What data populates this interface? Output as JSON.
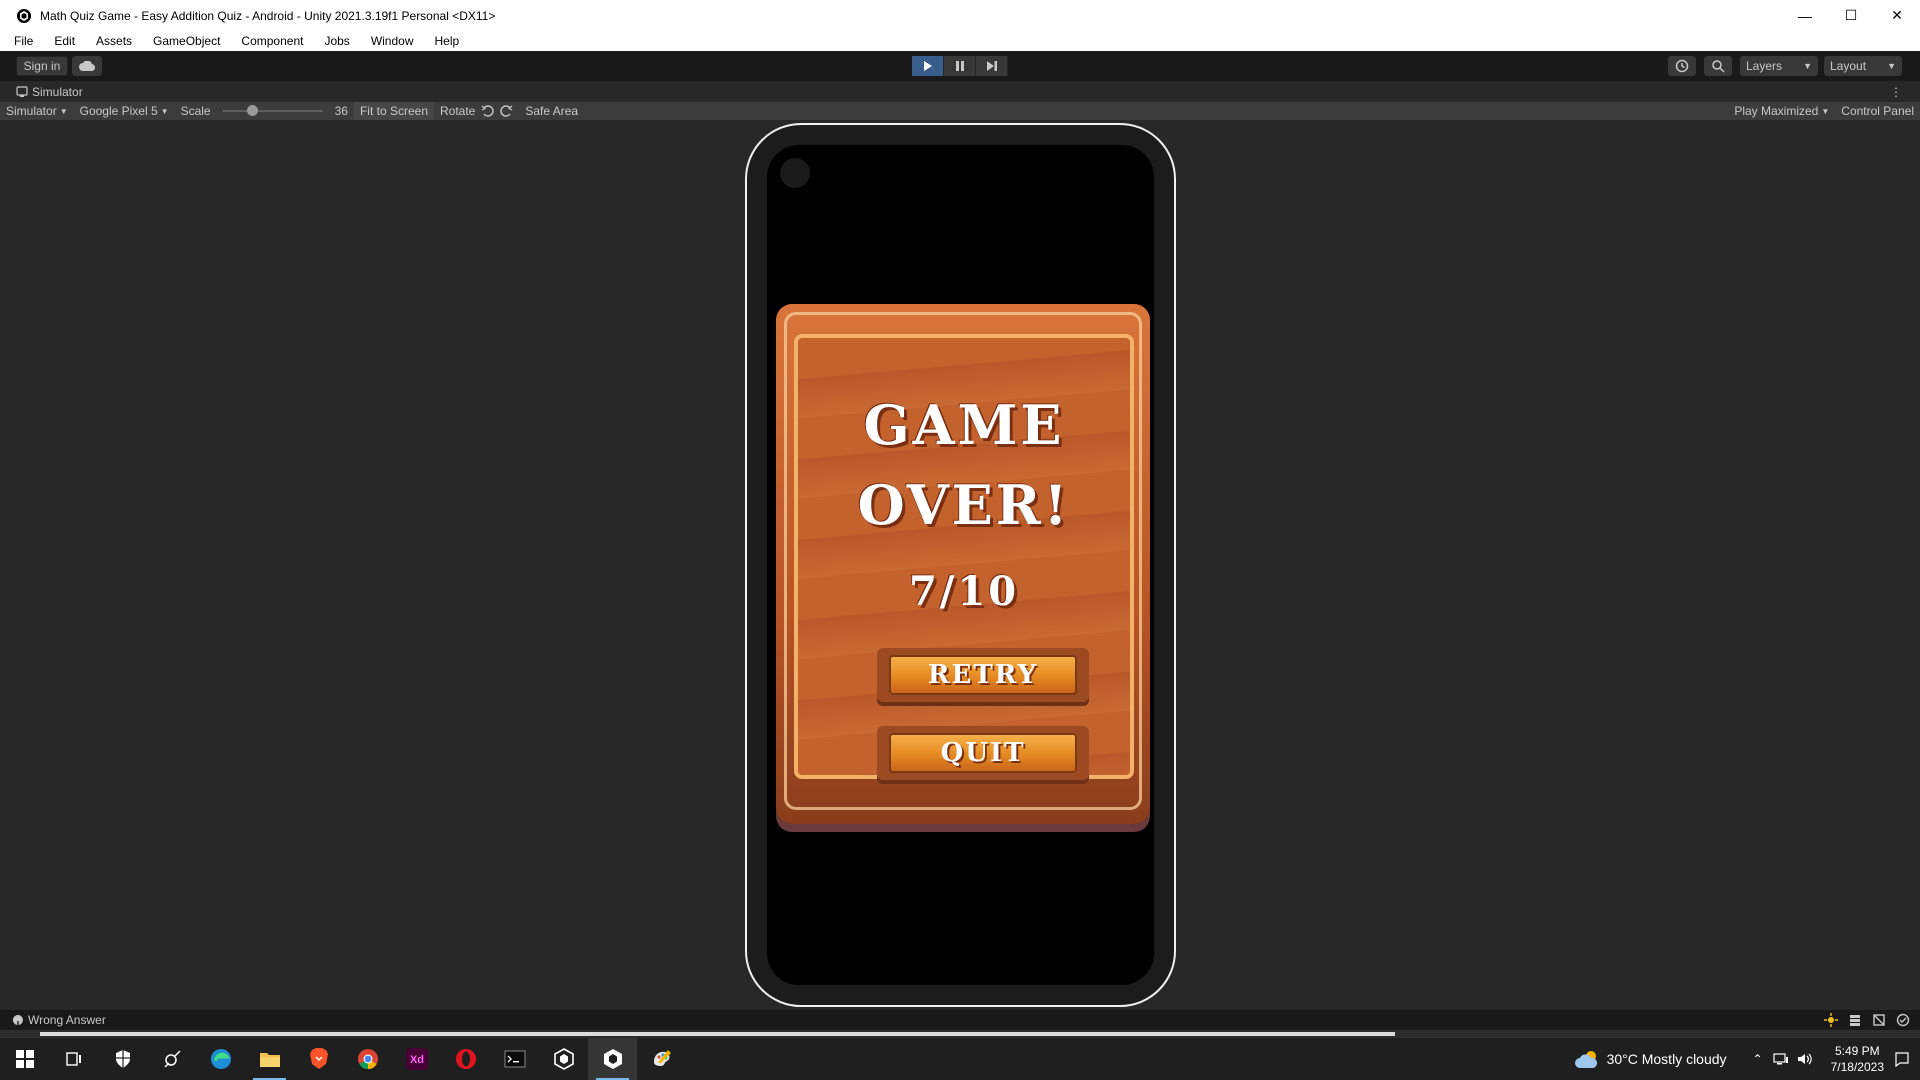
{
  "window": {
    "title": "Math Quiz Game - Easy Addition Quiz - Android - Unity 2021.3.19f1 Personal <DX11>",
    "minimize": "—",
    "maximize": "☐",
    "close": "✕"
  },
  "menu": [
    "File",
    "Edit",
    "Assets",
    "GameObject",
    "Component",
    "Jobs",
    "Window",
    "Help"
  ],
  "toolbar": {
    "sign_in": "Sign in",
    "layers": "Layers",
    "layout": "Layout",
    "play_active": true
  },
  "panel": {
    "tab": "Simulator"
  },
  "simulator": {
    "mode": "Simulator",
    "device": "Google Pixel 5",
    "scale_label": "Scale",
    "scale_value": "36",
    "fit_to_screen": "Fit to Screen",
    "rotate": "Rotate",
    "safe_area": "Safe Area",
    "play_maximized": "Play Maximized",
    "control_panel": "Control Panel"
  },
  "game": {
    "title_line1": "GAME",
    "title_line2": "OVER!",
    "score": "7/10",
    "retry": "RETRY",
    "quit": "QUIT"
  },
  "status": {
    "message": "Wrong Answer"
  },
  "taskbar": {
    "apps": [
      "start-icon",
      "task-view-icon",
      "security-icon",
      "satellite-app-icon",
      "edge-icon",
      "file-explorer-icon",
      "brave-icon",
      "chrome-icon",
      "adobe-xd-icon",
      "opera-icon",
      "terminal-icon",
      "unity-hub-icon",
      "unity-editor-icon",
      "paint-icon"
    ],
    "weather": "30°C  Mostly cloudy",
    "time": "5:49 PM",
    "date": "7/18/2023"
  },
  "colors": {
    "play_active": "#3a5e8c",
    "board": "#c4622d",
    "button": "#e58a22"
  }
}
